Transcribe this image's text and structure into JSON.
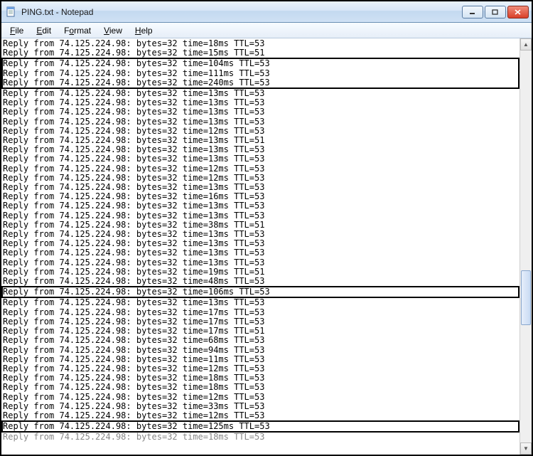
{
  "window": {
    "title": "PING.txt - Notepad"
  },
  "menubar": {
    "file": {
      "u": "F",
      "rest": "ile"
    },
    "edit": {
      "u": "E",
      "rest": "dit"
    },
    "format": {
      "u": "o",
      "pre": "F",
      "rest": "rmat"
    },
    "view": {
      "u": "V",
      "rest": "iew"
    },
    "help": {
      "u": "H",
      "rest": "elp"
    }
  },
  "scroll": {
    "thumb_top_pct": 56,
    "thumb_height_pct": 14
  },
  "ping": {
    "ip": "74.125.224.98",
    "bytes": 32,
    "lines": [
      {
        "time": 18,
        "ttl": 53
      },
      {
        "time": 15,
        "ttl": 51,
        "partial_bottom": true
      },
      {
        "time": 104,
        "ttl": 53,
        "hl": "a"
      },
      {
        "time": 111,
        "ttl": 53,
        "hl": "a"
      },
      {
        "time": 240,
        "ttl": 53,
        "hl": "a"
      },
      {
        "time": 13,
        "ttl": 53,
        "partial_top": true
      },
      {
        "time": 13,
        "ttl": 53
      },
      {
        "time": 13,
        "ttl": 53
      },
      {
        "time": 13,
        "ttl": 53
      },
      {
        "time": 12,
        "ttl": 53
      },
      {
        "time": 13,
        "ttl": 51
      },
      {
        "time": 13,
        "ttl": 53
      },
      {
        "time": 13,
        "ttl": 53
      },
      {
        "time": 12,
        "ttl": 53
      },
      {
        "time": 12,
        "ttl": 53
      },
      {
        "time": 13,
        "ttl": 53
      },
      {
        "time": 16,
        "ttl": 53
      },
      {
        "time": 13,
        "ttl": 53
      },
      {
        "time": 13,
        "ttl": 53
      },
      {
        "time": 38,
        "ttl": 51
      },
      {
        "time": 13,
        "ttl": 53
      },
      {
        "time": 13,
        "ttl": 53
      },
      {
        "time": 13,
        "ttl": 53
      },
      {
        "time": 13,
        "ttl": 53
      },
      {
        "time": 19,
        "ttl": 51
      },
      {
        "time": 48,
        "ttl": 53,
        "partial_bottom": true
      },
      {
        "time": 106,
        "ttl": 53,
        "hl": "b"
      },
      {
        "time": 13,
        "ttl": 53,
        "partial_top": true
      },
      {
        "time": 17,
        "ttl": 53
      },
      {
        "time": 17,
        "ttl": 53
      },
      {
        "time": 17,
        "ttl": 51
      },
      {
        "time": 68,
        "ttl": 53
      },
      {
        "time": 94,
        "ttl": 53
      },
      {
        "time": 11,
        "ttl": 53
      },
      {
        "time": 12,
        "ttl": 53
      },
      {
        "time": 18,
        "ttl": 53
      },
      {
        "time": 18,
        "ttl": 53
      },
      {
        "time": 12,
        "ttl": 53
      },
      {
        "time": 33,
        "ttl": 53
      },
      {
        "time": 12,
        "ttl": 53,
        "partial_bottom": true
      },
      {
        "time": 125,
        "ttl": 53,
        "hl": "c"
      },
      {
        "time": 18,
        "ttl": 53,
        "partial_top": true,
        "faded": true
      }
    ]
  }
}
